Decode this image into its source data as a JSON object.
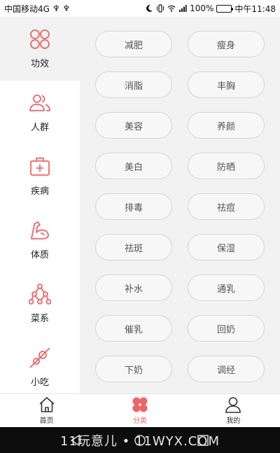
{
  "status_bar": {
    "carrier": "中国移动4G",
    "usb_glyphs": "♆ ♆",
    "battery": "100%",
    "time": "中午11:48"
  },
  "sidebar": {
    "items": [
      {
        "label": "功效",
        "icon": "four-circles-icon"
      },
      {
        "label": "人群",
        "icon": "people-icon"
      },
      {
        "label": "疾病",
        "icon": "medical-kit-icon"
      },
      {
        "label": "体质",
        "icon": "flexed-arm-icon"
      },
      {
        "label": "菜系",
        "icon": "network-icon"
      },
      {
        "label": "小吃",
        "icon": "skewer-icon"
      }
    ]
  },
  "tags": [
    "减肥",
    "瘦身",
    "消脂",
    "丰胸",
    "美容",
    "养颜",
    "美白",
    "防晒",
    "排毒",
    "祛痘",
    "祛斑",
    "保湿",
    "补水",
    "通乳",
    "催乳",
    "回奶",
    "下奶",
    "调经"
  ],
  "bottom_nav": {
    "items": [
      {
        "label": "首页",
        "icon": "home-icon"
      },
      {
        "label": "分类",
        "icon": "category-icon"
      },
      {
        "label": "我的",
        "icon": "user-icon"
      }
    ]
  },
  "watermark": "11玩意儿 • 11WYX.COM",
  "colors": {
    "accent": "#f06466",
    "background": "#f2f2f2",
    "tag_border": "#d6d6d6"
  }
}
